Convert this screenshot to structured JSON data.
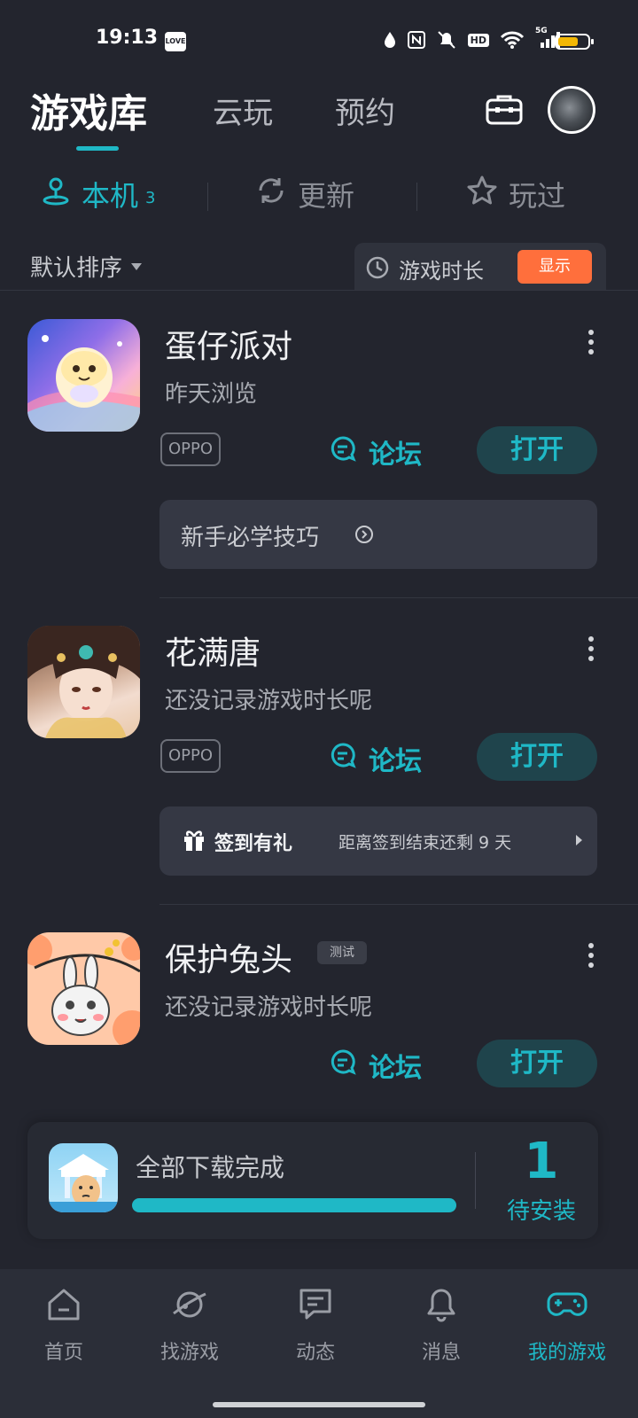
{
  "status_bar": {
    "time": "19:13",
    "love_badge": "LOVE",
    "network": "5G",
    "hd": "HD"
  },
  "header": {
    "tabs": [
      "游戏库",
      "云玩",
      "预约"
    ],
    "active_tab": 0
  },
  "sub_tabs": [
    {
      "label": "本机",
      "count": "3",
      "icon": "location-person-icon"
    },
    {
      "label": "更新",
      "icon": "refresh-icon"
    },
    {
      "label": "玩过",
      "icon": "star-icon"
    }
  ],
  "sort": {
    "label": "默认排序"
  },
  "time_toggle": {
    "label": "游戏时长",
    "button": "显示"
  },
  "games": [
    {
      "name": "蛋仔派对",
      "subtitle": "昨天浏览",
      "tag": "OPPO",
      "forum": "论坛",
      "open": "打开",
      "info": "新手必学技巧"
    },
    {
      "name": "花满唐",
      "subtitle": "还没记录游戏时长呢",
      "tag": "OPPO",
      "forum": "论坛",
      "open": "打开",
      "gift_title": "签到有礼",
      "gift_desc": "距离签到结束还剩 9 天"
    },
    {
      "name": "保护兔头",
      "badge": "测试",
      "subtitle": "还没记录游戏时长呢",
      "forum": "论坛",
      "open": "打开"
    }
  ],
  "download": {
    "text": "全部下载完成",
    "progress": 1.0,
    "count": "1",
    "count_label": "待安装"
  },
  "bottom_nav": [
    {
      "label": "首页",
      "icon": "home-icon"
    },
    {
      "label": "找游戏",
      "icon": "planet-icon"
    },
    {
      "label": "动态",
      "icon": "message-icon"
    },
    {
      "label": "消息",
      "icon": "bell-icon"
    },
    {
      "label": "我的游戏",
      "icon": "gamepad-icon"
    }
  ],
  "colors": {
    "accent": "#1fb8c6",
    "orange": "#ff6f3c",
    "background": "#23252e"
  }
}
